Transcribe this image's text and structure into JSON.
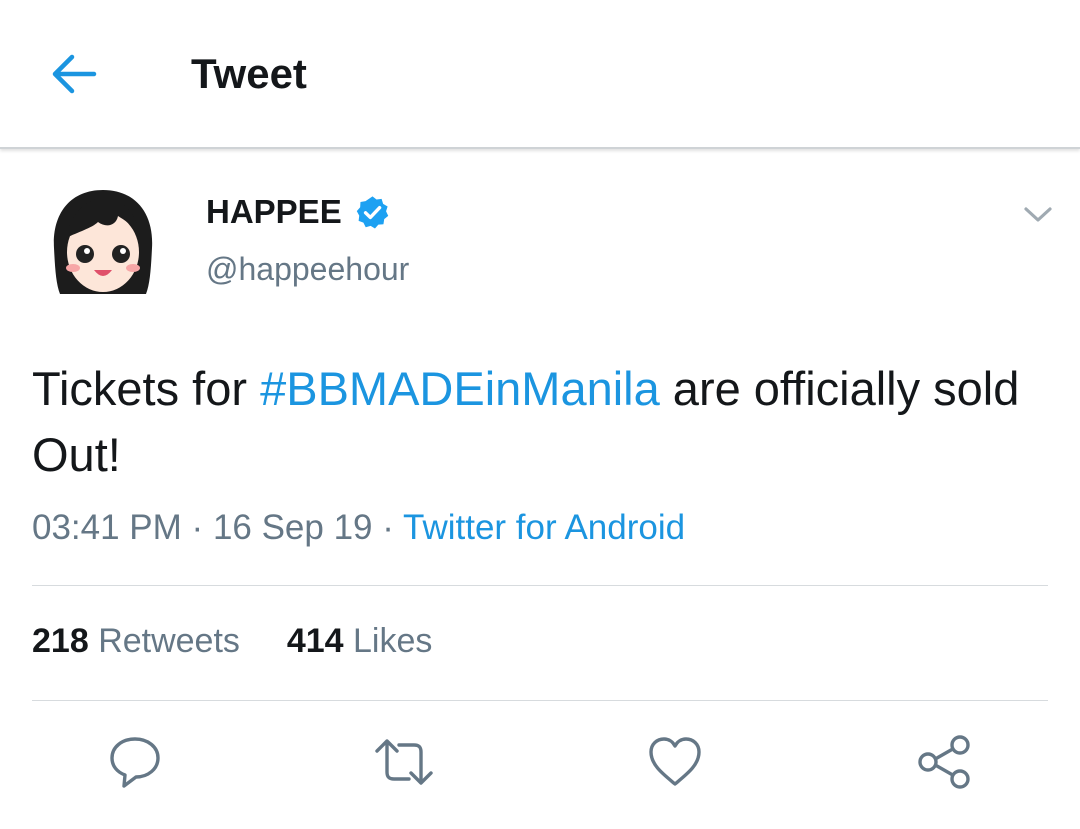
{
  "header": {
    "title": "Tweet",
    "back_icon": "arrow-left-icon"
  },
  "tweet": {
    "author_name": "HAPPEE",
    "verified_icon": "verified-badge-icon",
    "handle": "@happeehour",
    "text_before": "Tickets for ",
    "hashtag": "#BBMADEinManila",
    "text_after": " are officially sold Out!",
    "time": "03:41 PM",
    "date": "16 Sep 19",
    "separator": "·",
    "source": "Twitter for Android"
  },
  "stats": {
    "retweets_count": "218",
    "retweets_label": "Retweets",
    "likes_count": "414",
    "likes_label": "Likes"
  },
  "actions": [
    "reply-icon",
    "retweet-icon",
    "like-icon",
    "share-icon"
  ],
  "colors": {
    "accent": "#1b95e0",
    "verified": "#1da1f2",
    "text_primary": "#14171a",
    "text_secondary": "#657786",
    "icon": "#657786",
    "divider": "#d7dbde"
  }
}
